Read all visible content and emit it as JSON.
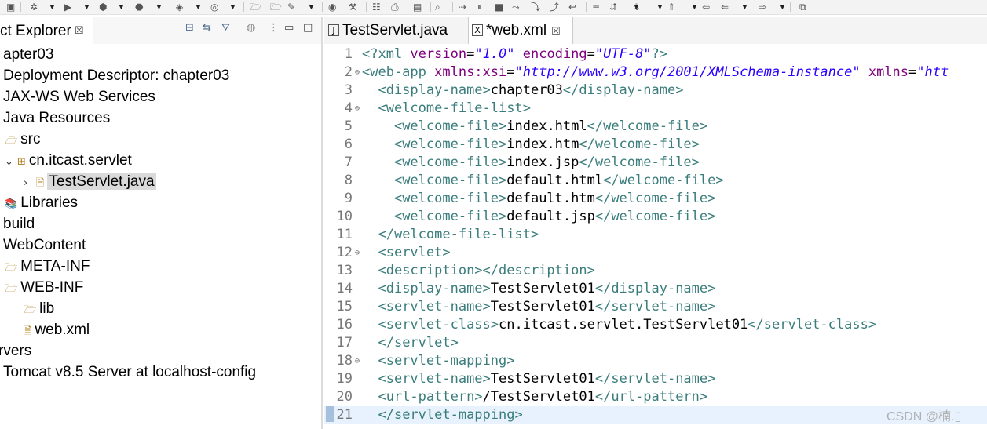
{
  "left_panel": {
    "title": "ct Explorer",
    "close": "☒",
    "tree": [
      {
        "label": "apter03",
        "icon": "",
        "twist": "",
        "indent": 0
      },
      {
        "label": "Deployment Descriptor: chapter03",
        "icon": "",
        "twist": "",
        "indent": 0
      },
      {
        "label": "JAX-WS Web Services",
        "icon": "",
        "twist": "",
        "indent": 0
      },
      {
        "label": "Java Resources",
        "icon": "",
        "twist": "",
        "indent": 0
      },
      {
        "label": "src",
        "icon": "🗁",
        "twist": "",
        "indent": 1
      },
      {
        "label": "cn.itcast.servlet",
        "icon": "⊞",
        "twist": "⌄",
        "indent": 1
      },
      {
        "label": "TestServlet.java",
        "icon": "🗎",
        "twist": "›",
        "indent": 2,
        "selected": true
      },
      {
        "label": "Libraries",
        "icon": "📚",
        "twist": "",
        "indent": 1
      },
      {
        "label": "build",
        "icon": "",
        "twist": "",
        "indent": 0
      },
      {
        "label": "WebContent",
        "icon": "",
        "twist": "",
        "indent": 0
      },
      {
        "label": "META-INF",
        "icon": "🗁",
        "twist": "",
        "indent": 1
      },
      {
        "label": "WEB-INF",
        "icon": "🗁",
        "twist": "",
        "indent": 1
      },
      {
        "label": "lib",
        "icon": "🗁",
        "twist": "",
        "indent": 2
      },
      {
        "label": "web.xml",
        "icon": "🗎",
        "twist": "",
        "indent": 2
      },
      {
        "label": "rvers",
        "icon": "",
        "twist": "",
        "indent": -1
      },
      {
        "label": "Tomcat v8.5 Server at localhost-config",
        "icon": "",
        "twist": "",
        "indent": 0
      }
    ]
  },
  "editor": {
    "tabs": [
      {
        "label": "TestServlet.java",
        "icon": "J",
        "active": false
      },
      {
        "label": "*web.xml",
        "icon": "X",
        "active": true,
        "close": "☒"
      }
    ],
    "lines": [
      {
        "n": "1",
        "fold": "",
        "parts": [
          [
            "pi",
            "<?xml "
          ],
          [
            "attr",
            "version"
          ],
          [
            "text",
            "="
          ],
          [
            "str",
            "\"1.0\""
          ],
          [
            "attr",
            " encoding"
          ],
          [
            "text",
            "="
          ],
          [
            "str",
            "\"UTF-8\""
          ],
          [
            "pi",
            "?>"
          ]
        ]
      },
      {
        "n": "2",
        "fold": "⊖",
        "parts": [
          [
            "tag",
            "<web-app "
          ],
          [
            "attr",
            "xmlns:xsi"
          ],
          [
            "text",
            "="
          ],
          [
            "str",
            "\"http://www.w3.org/2001/XMLSchema-instance\""
          ],
          [
            "attr",
            " xmlns"
          ],
          [
            "text",
            "="
          ],
          [
            "str",
            "\"htt"
          ]
        ]
      },
      {
        "n": "3",
        "fold": "",
        "parts": [
          [
            "text",
            "  "
          ],
          [
            "tag",
            "<display-name>"
          ],
          [
            "text",
            "chapter03"
          ],
          [
            "tag",
            "</display-name>"
          ]
        ]
      },
      {
        "n": "4",
        "fold": "⊖",
        "parts": [
          [
            "text",
            "  "
          ],
          [
            "tag",
            "<welcome-file-list>"
          ]
        ]
      },
      {
        "n": "5",
        "fold": "",
        "parts": [
          [
            "text",
            "    "
          ],
          [
            "tag",
            "<welcome-file>"
          ],
          [
            "text",
            "index.html"
          ],
          [
            "tag",
            "</welcome-file>"
          ]
        ]
      },
      {
        "n": "6",
        "fold": "",
        "parts": [
          [
            "text",
            "    "
          ],
          [
            "tag",
            "<welcome-file>"
          ],
          [
            "text",
            "index.htm"
          ],
          [
            "tag",
            "</welcome-file>"
          ]
        ]
      },
      {
        "n": "7",
        "fold": "",
        "parts": [
          [
            "text",
            "    "
          ],
          [
            "tag",
            "<welcome-file>"
          ],
          [
            "text",
            "index.jsp"
          ],
          [
            "tag",
            "</welcome-file>"
          ]
        ]
      },
      {
        "n": "8",
        "fold": "",
        "parts": [
          [
            "text",
            "    "
          ],
          [
            "tag",
            "<welcome-file>"
          ],
          [
            "text",
            "default.html"
          ],
          [
            "tag",
            "</welcome-file>"
          ]
        ]
      },
      {
        "n": "9",
        "fold": "",
        "parts": [
          [
            "text",
            "    "
          ],
          [
            "tag",
            "<welcome-file>"
          ],
          [
            "text",
            "default.htm"
          ],
          [
            "tag",
            "</welcome-file>"
          ]
        ]
      },
      {
        "n": "10",
        "fold": "",
        "parts": [
          [
            "text",
            "    "
          ],
          [
            "tag",
            "<welcome-file>"
          ],
          [
            "text",
            "default.jsp"
          ],
          [
            "tag",
            "</welcome-file>"
          ]
        ]
      },
      {
        "n": "11",
        "fold": "",
        "parts": [
          [
            "text",
            "  "
          ],
          [
            "tag",
            "</welcome-file-list>"
          ]
        ]
      },
      {
        "n": "12",
        "fold": "⊖",
        "parts": [
          [
            "text",
            "  "
          ],
          [
            "tag",
            "<servlet>"
          ]
        ]
      },
      {
        "n": "13",
        "fold": "",
        "parts": [
          [
            "text",
            "  "
          ],
          [
            "tag",
            "<description></description>"
          ]
        ]
      },
      {
        "n": "14",
        "fold": "",
        "parts": [
          [
            "text",
            "  "
          ],
          [
            "tag",
            "<display-name>"
          ],
          [
            "text",
            "TestServlet01"
          ],
          [
            "tag",
            "</display-name>"
          ]
        ]
      },
      {
        "n": "15",
        "fold": "",
        "parts": [
          [
            "text",
            "  "
          ],
          [
            "tag",
            "<servlet-name>"
          ],
          [
            "text",
            "TestServlet01"
          ],
          [
            "tag",
            "</servlet-name>"
          ]
        ]
      },
      {
        "n": "16",
        "fold": "",
        "parts": [
          [
            "text",
            "  "
          ],
          [
            "tag",
            "<servlet-class>"
          ],
          [
            "text",
            "cn.itcast.servlet.TestServlet01"
          ],
          [
            "tag",
            "</servlet-class>"
          ]
        ]
      },
      {
        "n": "17",
        "fold": "",
        "parts": [
          [
            "text",
            "  "
          ],
          [
            "tag",
            "</servlet>"
          ]
        ]
      },
      {
        "n": "18",
        "fold": "⊖",
        "parts": [
          [
            "text",
            "  "
          ],
          [
            "tag",
            "<servlet-mapping>"
          ]
        ]
      },
      {
        "n": "19",
        "fold": "",
        "parts": [
          [
            "text",
            "  "
          ],
          [
            "tag",
            "<servlet-name>"
          ],
          [
            "text",
            "TestServlet01"
          ],
          [
            "tag",
            "</servlet-name>"
          ]
        ]
      },
      {
        "n": "20",
        "fold": "",
        "parts": [
          [
            "text",
            "  "
          ],
          [
            "tag",
            "<url-pattern>"
          ],
          [
            "text",
            "/TestServlet01"
          ],
          [
            "tag",
            "</url-pattern>"
          ]
        ]
      },
      {
        "n": "21",
        "fold": "",
        "hl": true,
        "parts": [
          [
            "text",
            "  "
          ],
          [
            "tag",
            "</servlet-mapping>"
          ]
        ]
      }
    ]
  },
  "watermark": "CSDN @楠.▯",
  "colors": {
    "tag": "#3a7d7c",
    "attr": "#7f007f",
    "string": "#2a00ff",
    "highlight": "#e8f2fe"
  }
}
